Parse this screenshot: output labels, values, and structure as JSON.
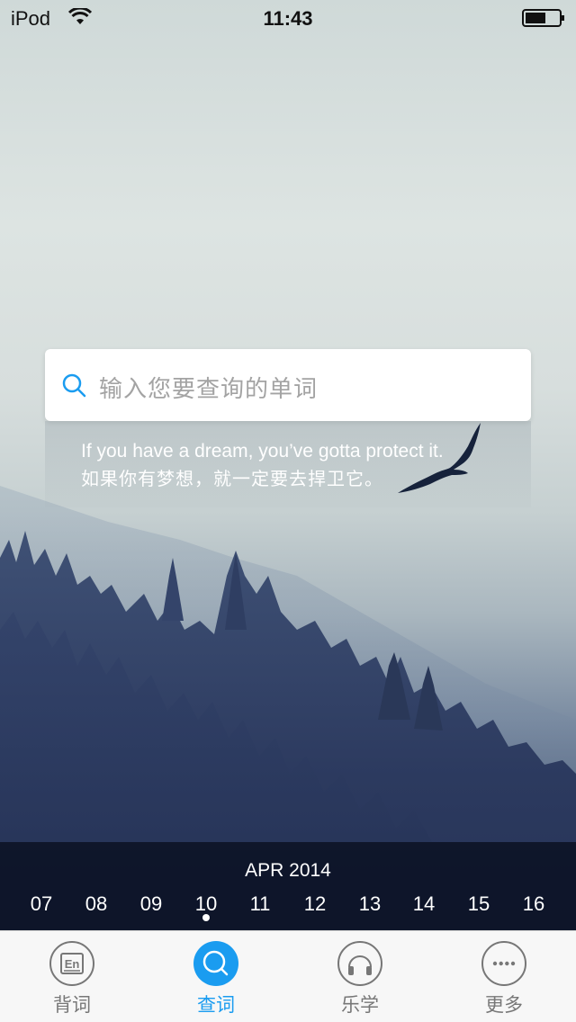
{
  "status_bar": {
    "carrier": "iPod",
    "time": "11:43"
  },
  "search": {
    "placeholder": "输入您要查询的单词"
  },
  "quote": {
    "english": "If you have a dream, you’ve gotta protect it.",
    "chinese": "如果你有梦想，就一定要去捍卫它。"
  },
  "date_strip": {
    "month": "APR 2014",
    "days": [
      "07",
      "08",
      "09",
      "10",
      "11",
      "12",
      "13",
      "14",
      "15",
      "16"
    ],
    "selected_day": "10"
  },
  "tabs": [
    {
      "label": "背词",
      "icon": "flashcard-icon",
      "active": false
    },
    {
      "label": "查词",
      "icon": "search-icon",
      "active": true
    },
    {
      "label": "乐学",
      "icon": "headphones-icon",
      "active": false
    },
    {
      "label": "更多",
      "icon": "more-icon",
      "active": false
    }
  ],
  "colors": {
    "accent": "#1a9cf0",
    "tab_inactive": "#777777"
  }
}
